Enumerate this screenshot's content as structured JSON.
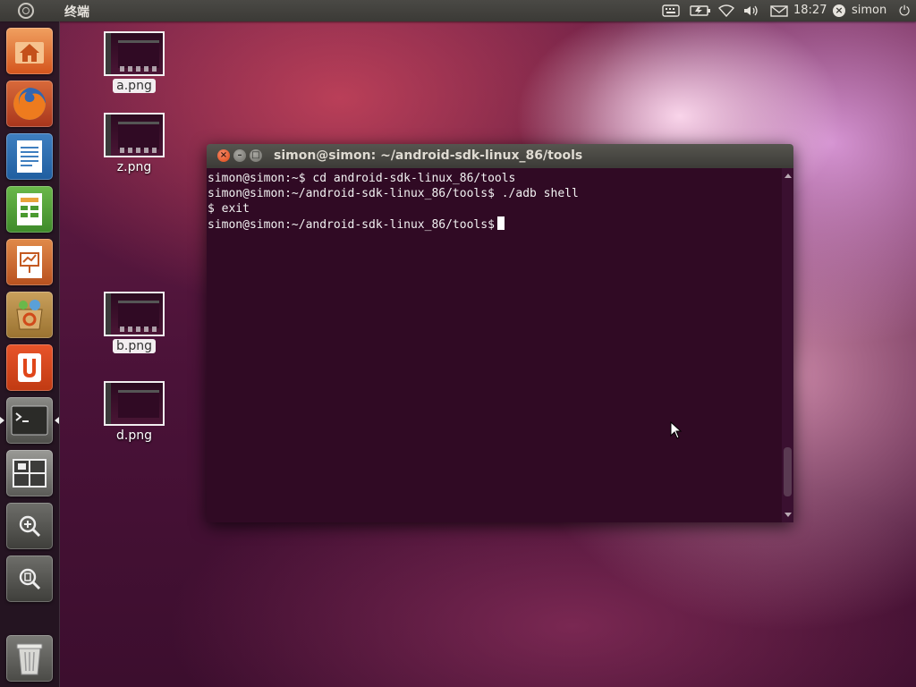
{
  "top_panel": {
    "app_title": "终端",
    "clock": "18:27",
    "user": "simon"
  },
  "desktop_icons": [
    {
      "label": "a.png",
      "selected": true
    },
    {
      "label": "z.png",
      "selected": false
    },
    {
      "label": "b.png",
      "selected": true
    },
    {
      "label": "d.png",
      "selected": false
    }
  ],
  "terminal": {
    "title": "simon@simon: ~/android-sdk-linux_86/tools",
    "lines": [
      "simon@simon:~$ cd android-sdk-linux_86/tools",
      "simon@simon:~/android-sdk-linux_86/tools$ ./adb shell",
      "$ exit",
      "simon@simon:~/android-sdk-linux_86/tools$"
    ],
    "close_symbol": "×",
    "minimize_symbol": "–",
    "maximize_symbol": "□"
  },
  "launcher": {
    "items": [
      {
        "name": "home-folder",
        "icon": "home-folder-icon"
      },
      {
        "name": "firefox",
        "icon": "firefox-icon"
      },
      {
        "name": "libreoffice-writer",
        "icon": "writer-icon"
      },
      {
        "name": "libreoffice-calc",
        "icon": "calc-icon"
      },
      {
        "name": "libreoffice-impress",
        "icon": "impress-icon"
      },
      {
        "name": "software-center",
        "icon": "software-center-icon"
      },
      {
        "name": "ubuntu-one",
        "icon": "ubuntu-one-icon"
      },
      {
        "name": "terminal",
        "icon": "terminal-icon"
      },
      {
        "name": "workspace-switcher",
        "icon": "workspace-icon"
      },
      {
        "name": "applications-lens",
        "icon": "apps-lens-icon"
      },
      {
        "name": "files-lens",
        "icon": "files-lens-icon"
      },
      {
        "name": "trash",
        "icon": "trash-icon"
      }
    ]
  },
  "colors": {
    "terminal_bg": "#300a24",
    "panel_bg": "#3b3a36",
    "close_button": "#dd4814"
  }
}
